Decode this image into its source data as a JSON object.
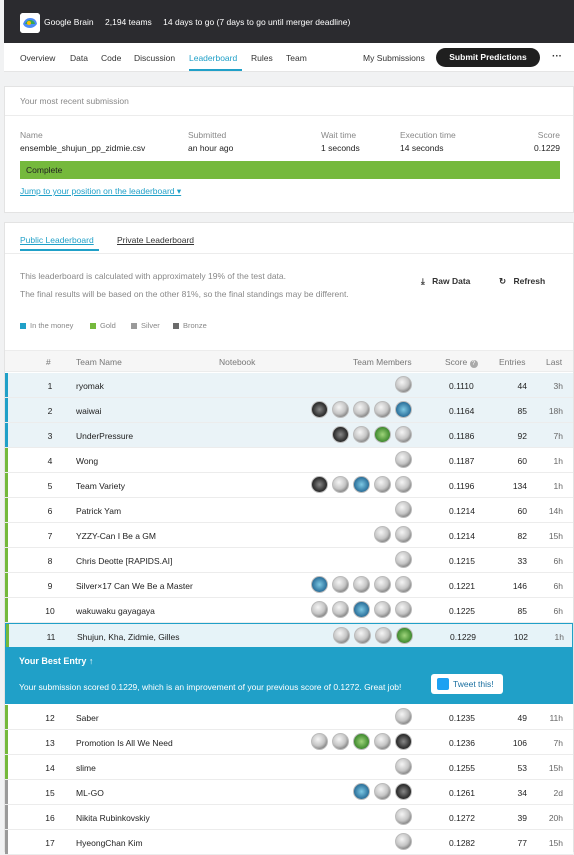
{
  "header": {
    "competition": "Google Brain",
    "teams": "2,194 teams",
    "deadline": "14 days to go (7 days to go until merger deadline)"
  },
  "nav": {
    "tabs": [
      "Overview",
      "Data",
      "Code",
      "Discussion",
      "Leaderboard",
      "Rules",
      "Team"
    ],
    "active_tab": "Leaderboard",
    "my_submissions": "My Submissions",
    "submit_button": "Submit Predictions",
    "more": "···"
  },
  "submission": {
    "title": "Your most recent submission",
    "name_label": "Name",
    "name": "ensemble_shujun_pp_zidmie.csv",
    "submitted_label": "Submitted",
    "submitted": "an hour ago",
    "wait_label": "Wait time",
    "wait": "1 seconds",
    "exec_label": "Execution time",
    "exec": "14 seconds",
    "score_label": "Score",
    "score": "0.1229",
    "status": "Complete",
    "jump_link": "Jump to your position on the leaderboard ▾"
  },
  "leaderboard": {
    "tabs": [
      "Public Leaderboard",
      "Private Leaderboard"
    ],
    "info_line1": "This leaderboard is calculated with approximately 19% of the test data.",
    "info_line2": "The final results will be based on the other 81%, so the final standings may be different.",
    "raw_data": "Raw Data",
    "refresh": "Refresh",
    "legend": [
      {
        "label": "In the money",
        "color": "#20a0c8"
      },
      {
        "label": "Gold",
        "color": "#75b93c"
      },
      {
        "label": "Silver",
        "color": "#9a9a9a"
      },
      {
        "label": "Bronze",
        "color": "#6b6b6b"
      }
    ],
    "columns": [
      "#",
      "Team Name",
      "Notebook",
      "Team Members",
      "Score",
      "Entries",
      "Last"
    ],
    "rows": [
      {
        "rank": "1",
        "team": "ryomak",
        "score": "0.1110",
        "entries": "44",
        "last": "3h"
      },
      {
        "rank": "2",
        "team": "waiwai",
        "score": "0.1164",
        "entries": "85",
        "last": "18h"
      },
      {
        "rank": "3",
        "team": "UnderPressure",
        "score": "0.1186",
        "entries": "92",
        "last": "7h"
      },
      {
        "rank": "4",
        "team": "Wong",
        "score": "0.1187",
        "entries": "60",
        "last": "1h"
      },
      {
        "rank": "5",
        "team": "Team Variety",
        "score": "0.1196",
        "entries": "134",
        "last": "1h"
      },
      {
        "rank": "6",
        "team": "Patrick Yam",
        "score": "0.1214",
        "entries": "60",
        "last": "14h"
      },
      {
        "rank": "7",
        "team": "YZZY-Can I Be a GM",
        "score": "0.1214",
        "entries": "82",
        "last": "15h"
      },
      {
        "rank": "8",
        "team": "Chris Deotte [RAPIDS.AI]",
        "score": "0.1215",
        "entries": "33",
        "last": "6h"
      },
      {
        "rank": "9",
        "team": "Silver×17 Can We Be a Master",
        "score": "0.1221",
        "entries": "146",
        "last": "6h"
      },
      {
        "rank": "10",
        "team": "wakuwaku gayagaya",
        "score": "0.1225",
        "entries": "85",
        "last": "6h"
      },
      {
        "rank": "11",
        "team": "Shujun, Kha, Zidmie, Gilles",
        "score": "0.1229",
        "entries": "102",
        "last": "1h"
      },
      {
        "rank": "12",
        "team": "Saber",
        "score": "0.1235",
        "entries": "49",
        "last": "11h"
      },
      {
        "rank": "13",
        "team": "Promotion Is All We Need",
        "score": "0.1236",
        "entries": "106",
        "last": "7h"
      },
      {
        "rank": "14",
        "team": "slime",
        "score": "0.1255",
        "entries": "53",
        "last": "15h"
      },
      {
        "rank": "15",
        "team": "ML-GO",
        "score": "0.1261",
        "entries": "34",
        "last": "2d"
      },
      {
        "rank": "16",
        "team": "Nikita Rubinkovskiy",
        "score": "0.1272",
        "entries": "39",
        "last": "20h"
      },
      {
        "rank": "17",
        "team": "HyeongChan Kim",
        "score": "0.1282",
        "entries": "77",
        "last": "15h"
      }
    ],
    "best_entry": {
      "title": "Your Best Entry ↑",
      "message": "Your submission scored 0.1229, which is an improvement of your previous score of 0.1272. Great job!",
      "tweet": "Tweet this!"
    }
  }
}
